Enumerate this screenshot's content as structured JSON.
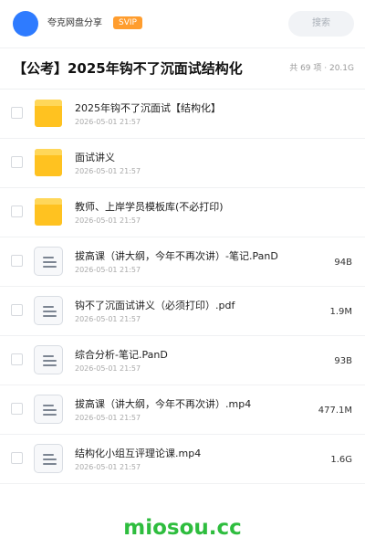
{
  "header": {
    "share_name": "夸克网盘分享",
    "badge": "SVIP",
    "search_label": "搜索"
  },
  "folder": {
    "title": "【公考】2025年钩不了沉面试结构化",
    "meta": "共 69 项 · 20.1G"
  },
  "items": [
    {
      "type": "folder",
      "name": "2025年钩不了沉面试【结构化】",
      "date": "2026-05-01 21:57",
      "size": ""
    },
    {
      "type": "folder",
      "name": "面试讲义",
      "date": "2026-05-01 21:57",
      "size": ""
    },
    {
      "type": "folder",
      "name": "教师、上岸学员模板库(不必打印)",
      "date": "2026-05-01 21:57",
      "size": ""
    },
    {
      "type": "file",
      "name": "拔高课（讲大纲，今年不再次讲）-笔记.PanD",
      "date": "2026-05-01 21:57",
      "size": "94B"
    },
    {
      "type": "file",
      "name": "钩不了沉面试讲义（必须打印）.pdf",
      "date": "2026-05-01 21:57",
      "size": "1.9M"
    },
    {
      "type": "file",
      "name": "综合分析-笔记.PanD",
      "date": "2026-05-01 21:57",
      "size": "93B"
    },
    {
      "type": "file",
      "name": "拔高课（讲大纲，今年不再次讲）.mp4",
      "date": "2026-05-01 21:57",
      "size": "477.1M"
    },
    {
      "type": "file",
      "name": "结构化小组互评理论课.mp4",
      "date": "2026-05-01 21:57",
      "size": "1.6G"
    }
  ],
  "watermark": "miosou.cc",
  "colors": {
    "avatar": "#2e7bff",
    "badge": "#ff9d2e",
    "folder_icon": "#ffc220",
    "watermark": "#2ebd3e"
  }
}
